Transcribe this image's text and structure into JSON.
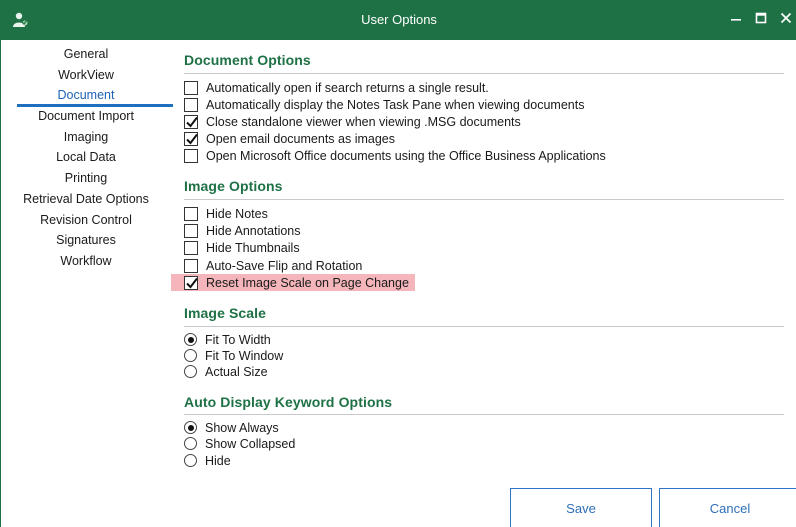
{
  "window": {
    "title": "User Options",
    "controls": {
      "minimize": "minimize-icon",
      "maximize": "maximize-icon",
      "close": "close-icon"
    }
  },
  "colors": {
    "title_bar": "#1e7145",
    "section_heading": "#1e7145",
    "active_nav": "#1e62b4",
    "highlight": "#f4b6ba",
    "button_border": "#2e75c7"
  },
  "sidebar": {
    "items": [
      {
        "label": "General"
      },
      {
        "label": "WorkView"
      },
      {
        "label": "Document",
        "active": true
      },
      {
        "label": "Document Import"
      },
      {
        "label": "Imaging"
      },
      {
        "label": "Local Data"
      },
      {
        "label": "Printing"
      },
      {
        "label": "Retrieval Date Options"
      },
      {
        "label": "Revision Control"
      },
      {
        "label": "Signatures"
      },
      {
        "label": "Workflow"
      }
    ]
  },
  "document_options": {
    "title": "Document Options",
    "items": [
      {
        "label": "Automatically open if search returns a single result.",
        "checked": false
      },
      {
        "label": "Automatically display the Notes Task Pane when viewing documents",
        "checked": false
      },
      {
        "label": "Close standalone viewer when viewing .MSG documents",
        "checked": true
      },
      {
        "label": "Open email documents as images",
        "checked": true
      },
      {
        "label": "Open Microsoft Office documents using the Office Business Applications",
        "checked": false
      }
    ]
  },
  "image_options": {
    "title": "Image Options",
    "items": [
      {
        "label": "Hide Notes",
        "checked": false
      },
      {
        "label": "Hide Annotations",
        "checked": false
      },
      {
        "label": "Hide Thumbnails",
        "checked": false
      },
      {
        "label": "Auto-Save Flip and Rotation",
        "checked": false
      },
      {
        "label": "Reset Image Scale on Page Change",
        "checked": true,
        "highlighted": true
      }
    ]
  },
  "image_scale": {
    "title": "Image Scale",
    "options": [
      {
        "label": "Fit To Width",
        "selected": true
      },
      {
        "label": "Fit To Window",
        "selected": false
      },
      {
        "label": "Actual Size",
        "selected": false
      }
    ]
  },
  "keyword_options": {
    "title": "Auto Display Keyword Options",
    "options": [
      {
        "label": "Show Always",
        "selected": true
      },
      {
        "label": "Show Collapsed",
        "selected": false
      },
      {
        "label": "Hide",
        "selected": false
      }
    ]
  },
  "buttons": {
    "save": "Save",
    "cancel": "Cancel"
  }
}
